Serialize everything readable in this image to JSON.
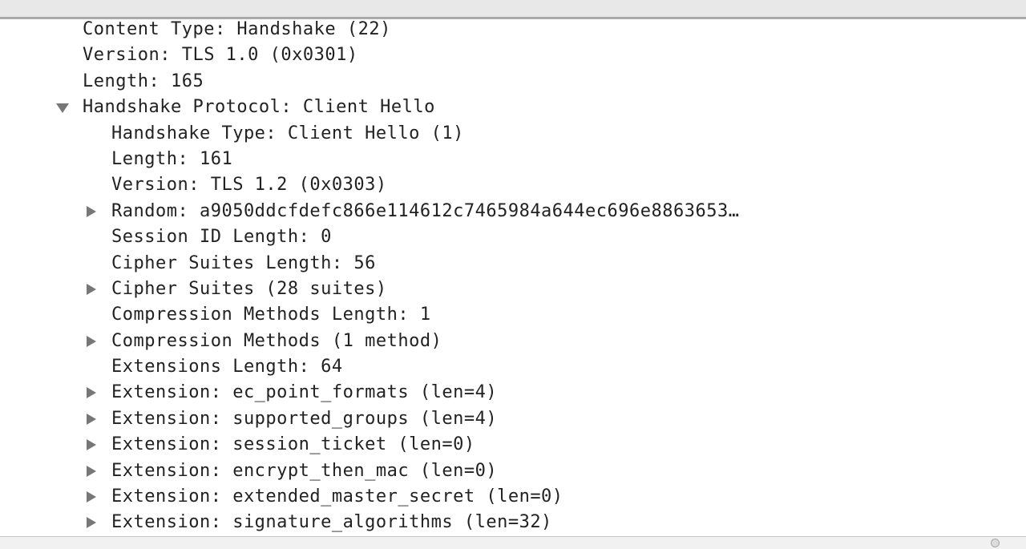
{
  "tree": {
    "rows": [
      {
        "label": "Content Type: Handshake (22)"
      },
      {
        "label": "Version: TLS 1.0 (0x0301)"
      },
      {
        "label": "Length: 165"
      },
      {
        "label": "Handshake Protocol: Client Hello",
        "toggle": "expanded"
      },
      {
        "label": "Handshake Type: Client Hello (1)"
      },
      {
        "label": "Length: 161"
      },
      {
        "label": "Version: TLS 1.2 (0x0303)"
      },
      {
        "label": "Random: a9050ddcfdefc866e114612c7465984a644ec696e8863653…",
        "toggle": "collapsed"
      },
      {
        "label": "Session ID Length: 0"
      },
      {
        "label": "Cipher Suites Length: 56"
      },
      {
        "label": "Cipher Suites (28 suites)",
        "toggle": "collapsed"
      },
      {
        "label": "Compression Methods Length: 1"
      },
      {
        "label": "Compression Methods (1 method)",
        "toggle": "collapsed"
      },
      {
        "label": "Extensions Length: 64"
      },
      {
        "label": "Extension: ec_point_formats (len=4)",
        "toggle": "collapsed"
      },
      {
        "label": "Extension: supported_groups (len=4)",
        "toggle": "collapsed"
      },
      {
        "label": "Extension: session_ticket (len=0)",
        "toggle": "collapsed"
      },
      {
        "label": "Extension: encrypt_then_mac (len=0)",
        "toggle": "collapsed"
      },
      {
        "label": "Extension: extended_master_secret (len=0)",
        "toggle": "collapsed"
      },
      {
        "label": "Extension: signature_algorithms (len=32)",
        "toggle": "collapsed"
      }
    ]
  },
  "icons": {
    "expanded": "disclosure-triangle-down-icon",
    "collapsed": "disclosure-triangle-right-icon"
  },
  "colors": {
    "text": "#222222",
    "triangle": "#777777",
    "top_bar": "#e8e8e8",
    "top_bar_border": "#a9a9a9"
  }
}
